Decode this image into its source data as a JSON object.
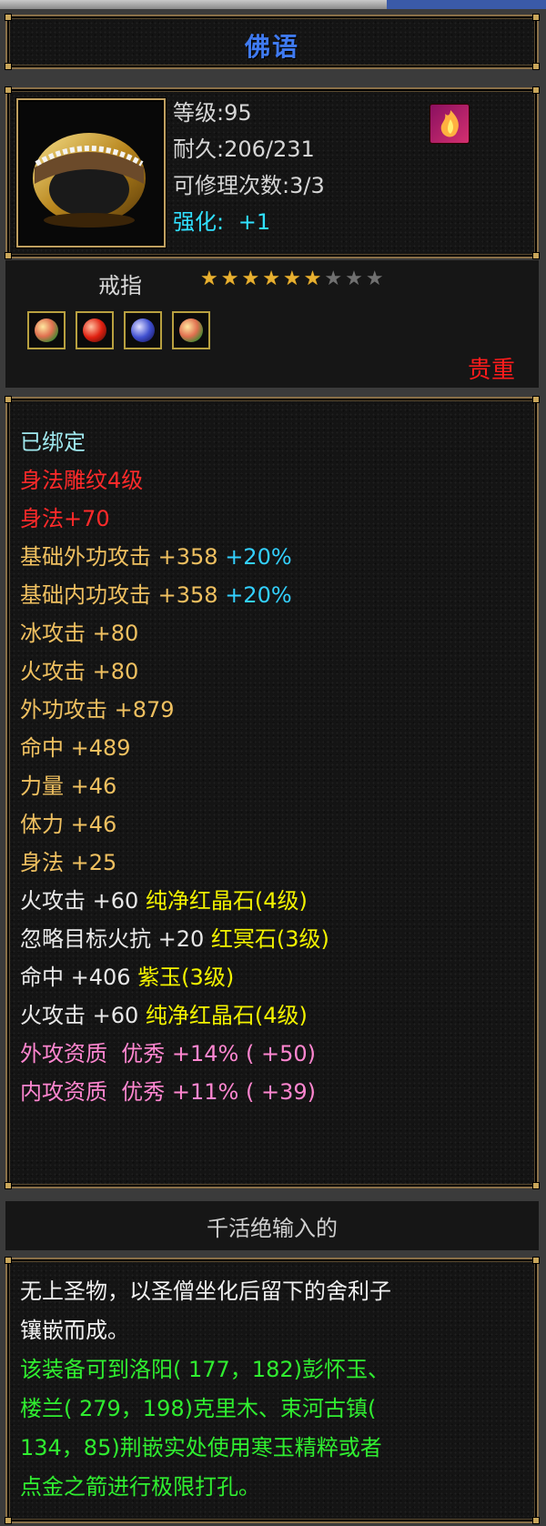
{
  "item": {
    "name": "佛语",
    "level": "等级:95",
    "durability": "耐久:206/231",
    "repair": "可修理次数:3/3",
    "enhance_label": "强化:",
    "enhance_value": "+1",
    "type": "戒指",
    "stars_filled": 6,
    "stars_total": 9,
    "rarity": "贵重",
    "gems": [
      "green-gem",
      "red-gem",
      "blue-gem",
      "green-gem"
    ]
  },
  "stats": {
    "bound": "已绑定",
    "engrave": "身法雕纹4级",
    "engrave_bonus": "身法+70",
    "base_outer": "基础外功攻击 +358",
    "base_outer_pct": "+20%",
    "base_inner": "基础内功攻击 +358",
    "base_inner_pct": "+20%",
    "ice": "冰攻击 +80",
    "fire": "火攻击 +80",
    "outer_atk": "外功攻击 +879",
    "hit": "命中 +489",
    "strength": "力量 +46",
    "vitality": "体力 +46",
    "agility": "身法 +25",
    "gem1_stat": "火攻击 +60",
    "gem1_name": "纯净红晶石(4级)",
    "gem2_stat": "忽略目标火抗 +20",
    "gem2_name": "红冥石(3级)",
    "gem3_stat": "命中 +406",
    "gem3_name": "紫玉(3级)",
    "gem4_stat": "火攻击 +60",
    "gem4_name": "纯净红晶石(4级)",
    "q_outer": "外攻资质  优秀 +14% ( +50)",
    "q_inner": "内攻资质  优秀 +11% ( +39)"
  },
  "author": "千活绝输入的",
  "description": {
    "line1": "无上圣物，以圣僧坐化后留下的舍利子",
    "line2": "镶嵌而成。",
    "green1": "该装备可到洛阳( 177，182)彭怀玉、",
    "green2": "楼兰( 279，198)克里木、束河古镇(",
    "green3": "134，85)荆嵌实处使用寒玉精粹或者",
    "green4": "点金之箭进行极限打孔。"
  },
  "colors": {
    "title": "#3f7af0",
    "stat_gold": "#efc060",
    "stat_red": "#ff2a2a",
    "percent_blue": "#33d0ff",
    "gem_yellow": "#f2f200",
    "quality_pink": "#ff86d0",
    "desc_green": "#30ee30"
  }
}
